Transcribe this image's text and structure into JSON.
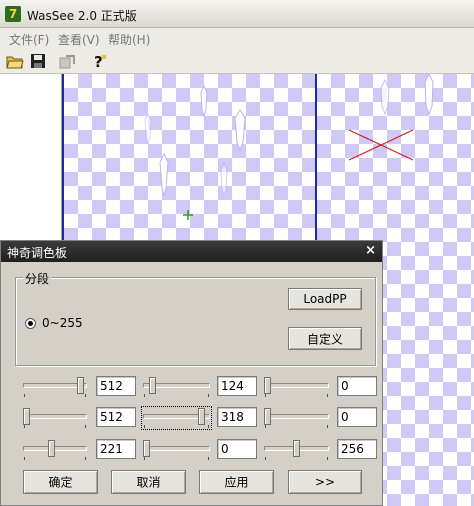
{
  "app": {
    "title": "WasSee 2.0 正式版",
    "logo_text": "7"
  },
  "menu": [
    {
      "label": "文件(F)"
    },
    {
      "label": "查看(V)"
    },
    {
      "label": "帮助(H)"
    }
  ],
  "toolbar": [
    {
      "icon": "open-folder-icon"
    },
    {
      "icon": "save-disk-icon"
    },
    {
      "icon": "export-icon"
    },
    {
      "icon": "help-question-icon"
    }
  ],
  "palette_dialog": {
    "title": "神奇调色板",
    "close": "×",
    "group_label": "分段",
    "radio_label": "0~255",
    "loadpp_label": "LoadPP",
    "custom_label": "自定义",
    "rows": [
      {
        "fields": [
          "512",
          "124",
          "0"
        ],
        "levels": [
          0.95,
          0.1,
          0.0
        ]
      },
      {
        "fields": [
          "512",
          "318",
          "0"
        ],
        "levels": [
          0.0,
          0.92,
          0.0
        ]
      },
      {
        "fields": [
          "221",
          "0",
          "256"
        ],
        "levels": [
          0.43,
          0.0,
          0.5
        ]
      }
    ],
    "buttons": {
      "ok": "确定",
      "cancel": "取消",
      "apply": "应用",
      "more": ">>"
    }
  },
  "colors": {
    "checker": "#cfc9f5",
    "frame_border": "#1e2a9a",
    "dialog_title": "#2b2b2b"
  }
}
